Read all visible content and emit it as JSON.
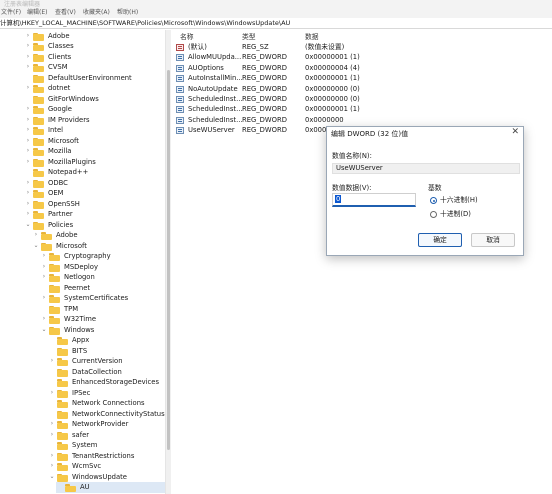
{
  "window": {
    "title": "注册表编辑器"
  },
  "menu": [
    "文件(F)",
    "编辑(E)",
    "查看(V)",
    "收藏夹(A)",
    "帮助(H)"
  ],
  "address": "计算机\\HKEY_LOCAL_MACHINE\\SOFTWARE\\Policies\\Microsoft\\Windows\\WindowsUpdate\\AU",
  "tree": [
    {
      "label": "Adobe",
      "indent": 1,
      "chevron": ">"
    },
    {
      "label": "Classes",
      "indent": 1,
      "chevron": ">"
    },
    {
      "label": "Clients",
      "indent": 1,
      "chevron": ">"
    },
    {
      "label": "CVSM",
      "indent": 1,
      "chevron": ">"
    },
    {
      "label": "DefaultUserEnvironment",
      "indent": 1,
      "chevron": ""
    },
    {
      "label": "dotnet",
      "indent": 1,
      "chevron": ">"
    },
    {
      "label": "GitForWindows",
      "indent": 1,
      "chevron": ""
    },
    {
      "label": "Google",
      "indent": 1,
      "chevron": ">"
    },
    {
      "label": "IM Providers",
      "indent": 1,
      "chevron": ">"
    },
    {
      "label": "Intel",
      "indent": 1,
      "chevron": ">"
    },
    {
      "label": "Microsoft",
      "indent": 1,
      "chevron": ">"
    },
    {
      "label": "Mozilla",
      "indent": 1,
      "chevron": ">"
    },
    {
      "label": "MozillaPlugins",
      "indent": 1,
      "chevron": ">"
    },
    {
      "label": "Notepad++",
      "indent": 1,
      "chevron": ""
    },
    {
      "label": "ODBC",
      "indent": 1,
      "chevron": ">"
    },
    {
      "label": "OEM",
      "indent": 1,
      "chevron": ">"
    },
    {
      "label": "OpenSSH",
      "indent": 1,
      "chevron": ">"
    },
    {
      "label": "Partner",
      "indent": 1,
      "chevron": ">"
    },
    {
      "label": "Policies",
      "indent": 1,
      "chevron": "v"
    },
    {
      "label": "Adobe",
      "indent": 2,
      "chevron": ">"
    },
    {
      "label": "Microsoft",
      "indent": 2,
      "chevron": "v"
    },
    {
      "label": "Cryptography",
      "indent": 3,
      "chevron": ">"
    },
    {
      "label": "MSDeploy",
      "indent": 3,
      "chevron": ">"
    },
    {
      "label": "Netlogon",
      "indent": 3,
      "chevron": ">"
    },
    {
      "label": "Peernet",
      "indent": 3,
      "chevron": ""
    },
    {
      "label": "SystemCertificates",
      "indent": 3,
      "chevron": ">"
    },
    {
      "label": "TPM",
      "indent": 3,
      "chevron": ""
    },
    {
      "label": "W32Time",
      "indent": 3,
      "chevron": ">"
    },
    {
      "label": "Windows",
      "indent": 3,
      "chevron": "v"
    },
    {
      "label": "Appx",
      "indent": 4,
      "chevron": ""
    },
    {
      "label": "BITS",
      "indent": 4,
      "chevron": ""
    },
    {
      "label": "CurrentVersion",
      "indent": 4,
      "chevron": ">"
    },
    {
      "label": "DataCollection",
      "indent": 4,
      "chevron": ""
    },
    {
      "label": "EnhancedStorageDevices",
      "indent": 4,
      "chevron": ""
    },
    {
      "label": "IPSec",
      "indent": 4,
      "chevron": ">"
    },
    {
      "label": "Network Connections",
      "indent": 4,
      "chevron": ""
    },
    {
      "label": "NetworkConnectivityStatusIndi",
      "indent": 4,
      "chevron": ""
    },
    {
      "label": "NetworkProvider",
      "indent": 4,
      "chevron": ">"
    },
    {
      "label": "safer",
      "indent": 4,
      "chevron": ">"
    },
    {
      "label": "System",
      "indent": 4,
      "chevron": ""
    },
    {
      "label": "TenantRestrictions",
      "indent": 4,
      "chevron": ">"
    },
    {
      "label": "WcmSvc",
      "indent": 4,
      "chevron": ">"
    },
    {
      "label": "WindowsUpdate",
      "indent": 4,
      "chevron": "v"
    },
    {
      "label": "AU",
      "indent": 5,
      "chevron": "",
      "selected": true
    }
  ],
  "columns": {
    "name": "名称",
    "type": "类型",
    "data": "数据"
  },
  "values": [
    {
      "name": "(默认)",
      "type": "REG_SZ",
      "data": "(数值未设置)",
      "icon": "string-value-icon"
    },
    {
      "name": "AllowMUUpda...",
      "type": "REG_DWORD",
      "data": "0x00000001 (1)",
      "icon": "dword-value-icon"
    },
    {
      "name": "AUOptions",
      "type": "REG_DWORD",
      "data": "0x00000004 (4)",
      "icon": "dword-value-icon"
    },
    {
      "name": "AutoInstallMin...",
      "type": "REG_DWORD",
      "data": "0x00000001 (1)",
      "icon": "dword-value-icon"
    },
    {
      "name": "NoAutoUpdate",
      "type": "REG_DWORD",
      "data": "0x00000000 (0)",
      "icon": "dword-value-icon"
    },
    {
      "name": "ScheduledInst...",
      "type": "REG_DWORD",
      "data": "0x00000000 (0)",
      "icon": "dword-value-icon"
    },
    {
      "name": "ScheduledInst...",
      "type": "REG_DWORD",
      "data": "0x00000001 (1)",
      "icon": "dword-value-icon"
    },
    {
      "name": "ScheduledInst...",
      "type": "REG_DWORD",
      "data": "0x0000000",
      "icon": "dword-value-icon"
    },
    {
      "name": "UseWUServer",
      "type": "REG_DWORD",
      "data": "0x0000000",
      "icon": "dword-value-icon"
    }
  ],
  "dialog": {
    "title": "编辑 DWORD (32 位)值",
    "close": "✕",
    "name_label": "数值名称(N):",
    "name_value": "UseWUServer",
    "data_label": "数值数据(V):",
    "data_value": "0",
    "base_label": "基数",
    "base_hex": "十六进制(H)",
    "base_dec": "十进制(D)",
    "ok": "确定",
    "cancel": "取消"
  }
}
